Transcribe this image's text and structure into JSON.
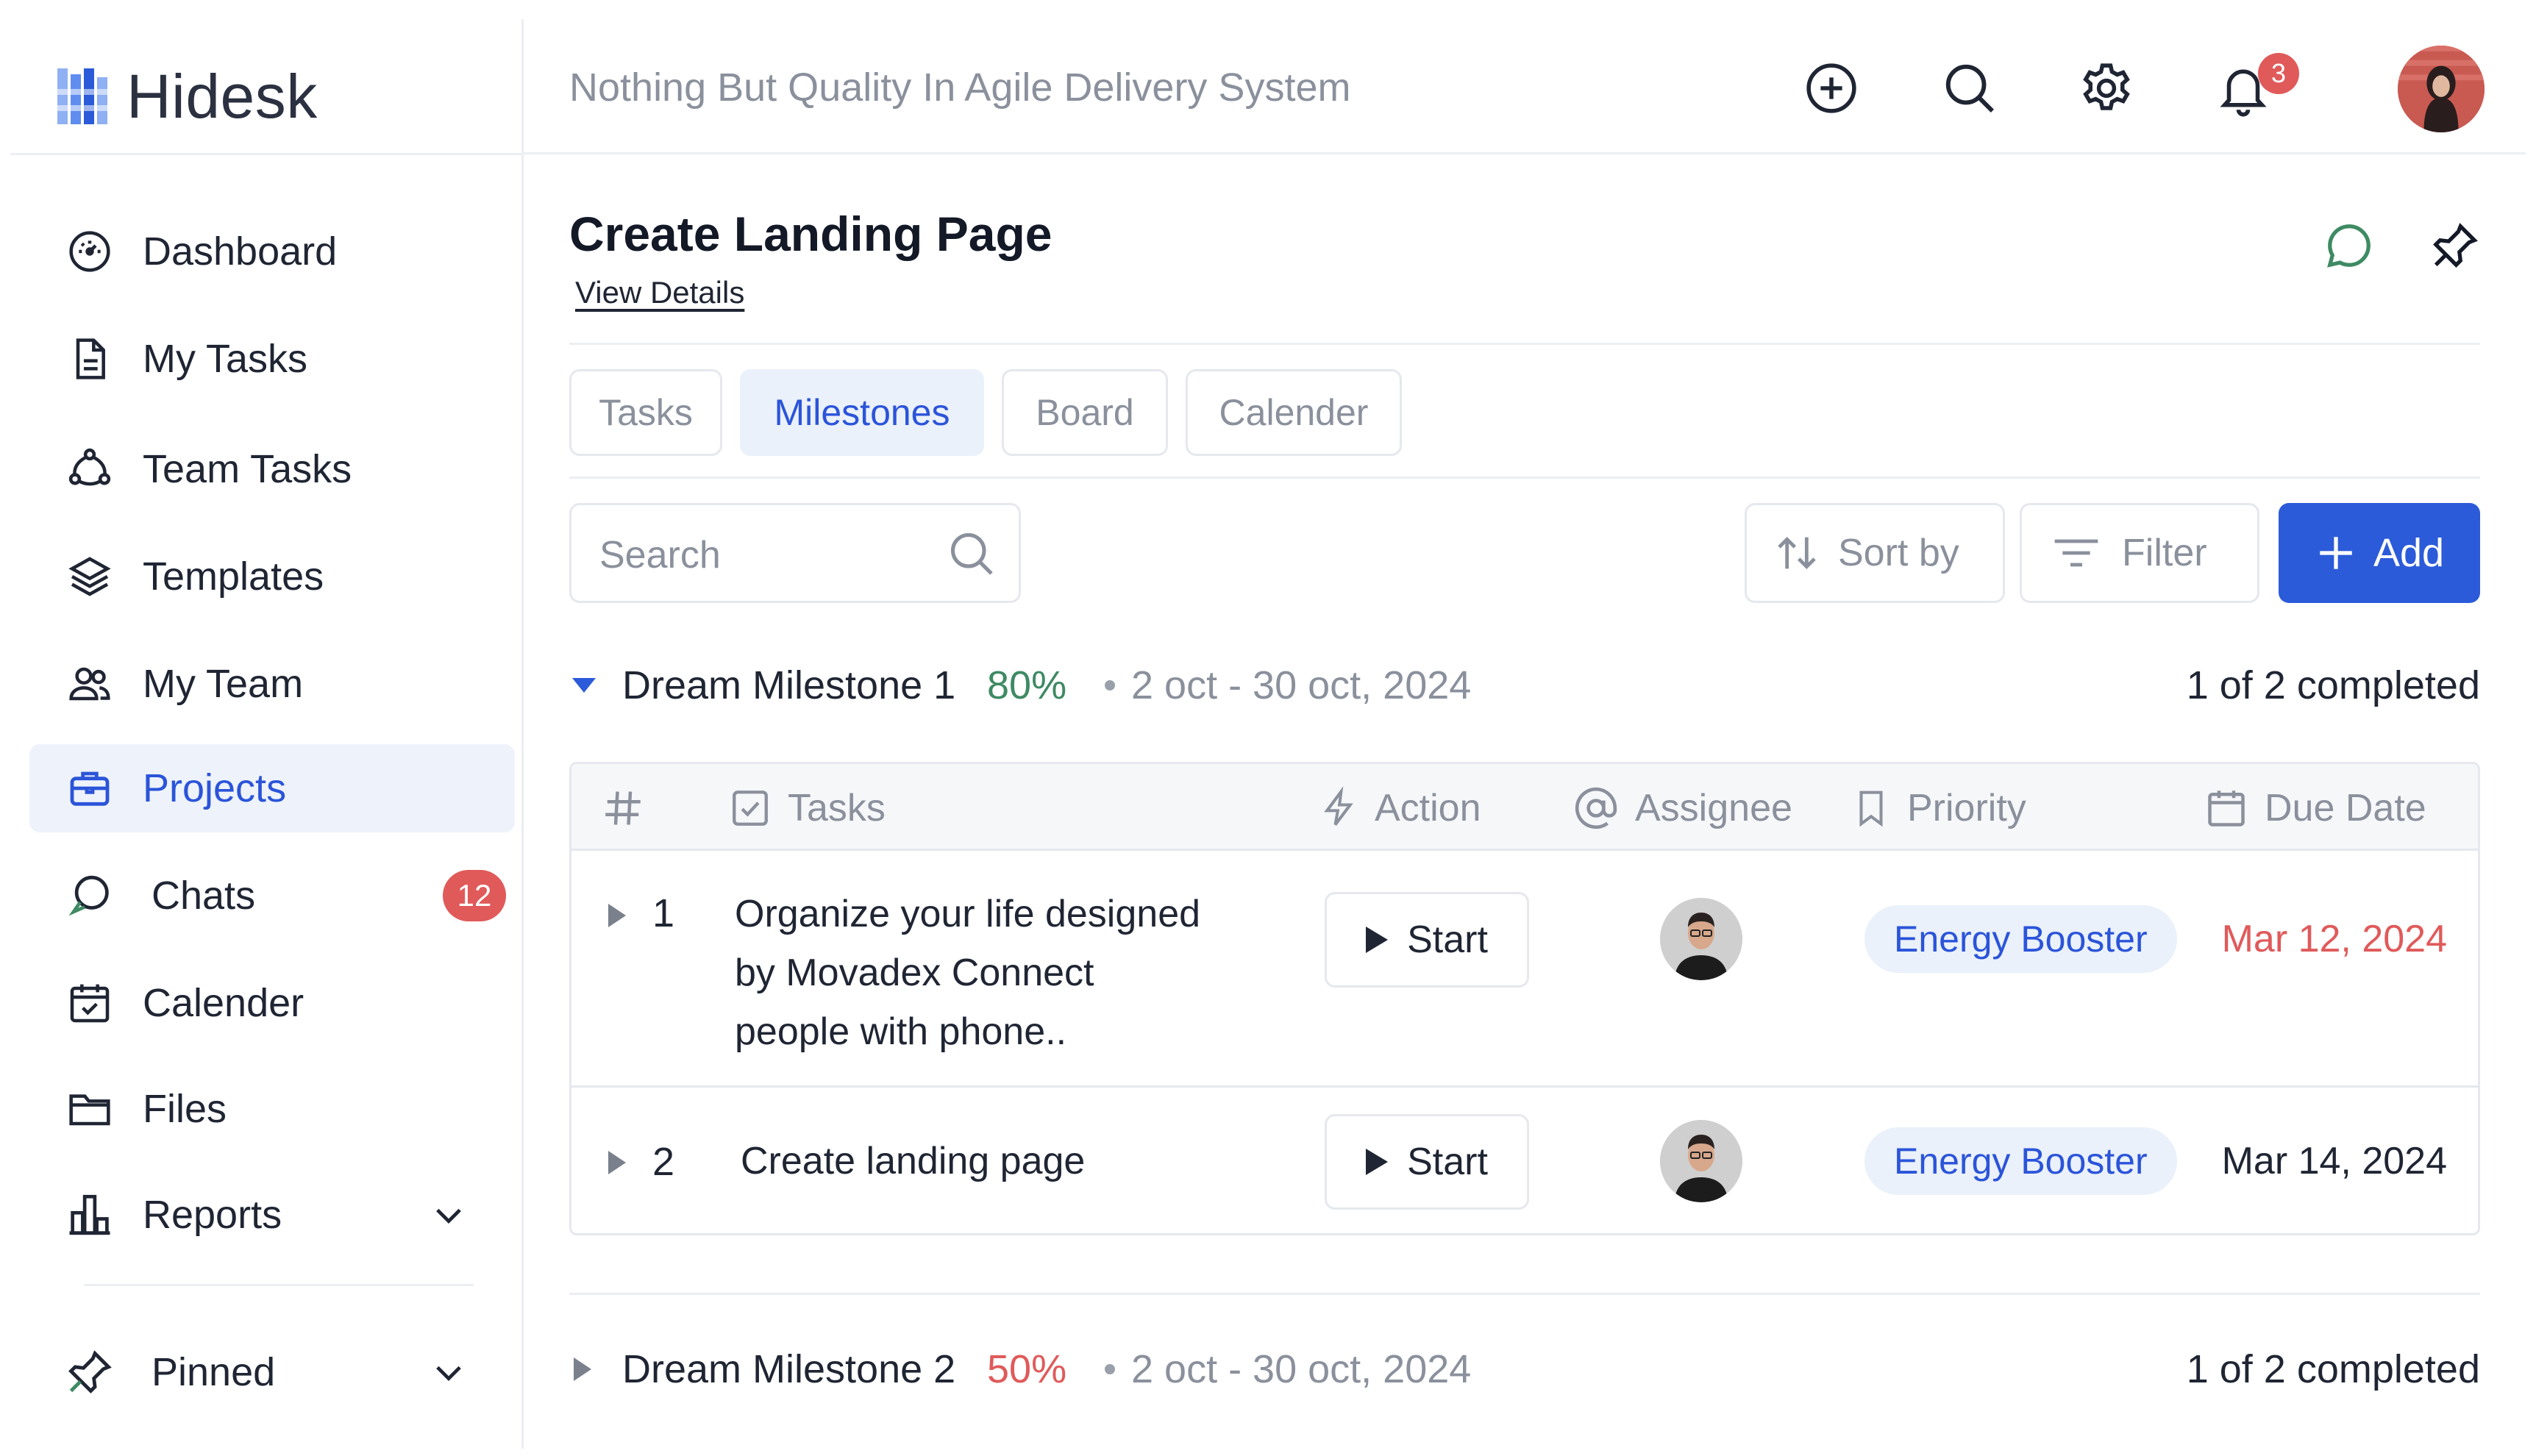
{
  "app": {
    "name": "Hidesk",
    "tagline": "Nothing But Quality In Agile Delivery System"
  },
  "sidebar": {
    "items": [
      {
        "label": "Dashboard",
        "icon": "dashboard-gauge-icon"
      },
      {
        "label": "My Tasks",
        "icon": "document-icon"
      },
      {
        "label": "Team Tasks",
        "icon": "team-network-icon"
      },
      {
        "label": "Templates",
        "icon": "layers-icon"
      },
      {
        "label": "My Team",
        "icon": "users-icon"
      },
      {
        "label": "Projects",
        "icon": "briefcase-icon",
        "active": true
      },
      {
        "label": "Chats",
        "icon": "chat-icon",
        "badge": "12"
      },
      {
        "label": "Calender",
        "icon": "calendar-check-icon"
      },
      {
        "label": "Files",
        "icon": "folder-icon"
      },
      {
        "label": "Reports",
        "icon": "bar-chart-icon"
      }
    ],
    "pinned_label": "Pinned"
  },
  "header": {
    "notification_count": "3"
  },
  "page": {
    "title": "Create Landing Page",
    "view_details": "View Details",
    "tabs": [
      "Tasks",
      "Milestones",
      "Board",
      "Calender"
    ],
    "active_tab": "Milestones"
  },
  "toolbar": {
    "search_placeholder": "Search",
    "sort_label": "Sort by",
    "filter_label": "Filter",
    "add_label": "Add"
  },
  "milestones": [
    {
      "name": "Dream Milestone 1",
      "percent": "80%",
      "dates": "2 oct - 30 oct, 2024",
      "completed": "1 of 2 completed",
      "percent_color": "#3e8a63",
      "expanded": true
    },
    {
      "name": "Dream Milestone 2",
      "percent": "50%",
      "dates": "2 oct - 30 oct, 2024",
      "completed": "1 of 2 completed",
      "percent_color": "#e05a5a",
      "expanded": false
    }
  ],
  "table": {
    "headers": {
      "num": "",
      "tasks": "Tasks",
      "action": "Action",
      "assignee": "Assignee",
      "priority": "Priority",
      "due": "Due Date"
    },
    "rows": [
      {
        "num": "1",
        "task_lines": [
          "Organize your life designed",
          "by Movadex Connect",
          "people with phone.."
        ],
        "action": "Start",
        "priority": "Energy Booster",
        "due": "Mar 12, 2024",
        "due_color": "#e05a5a"
      },
      {
        "num": "2",
        "task_lines": [
          "Create landing page"
        ],
        "action": "Start",
        "priority": "Energy Booster",
        "due": "Mar 14, 2024",
        "due_color": "#1f2533"
      }
    ]
  },
  "colors": {
    "accent": "#2b5bd9",
    "accent_light": "#eaf1fb",
    "danger": "#e05a5a",
    "success": "#3e8a63"
  }
}
